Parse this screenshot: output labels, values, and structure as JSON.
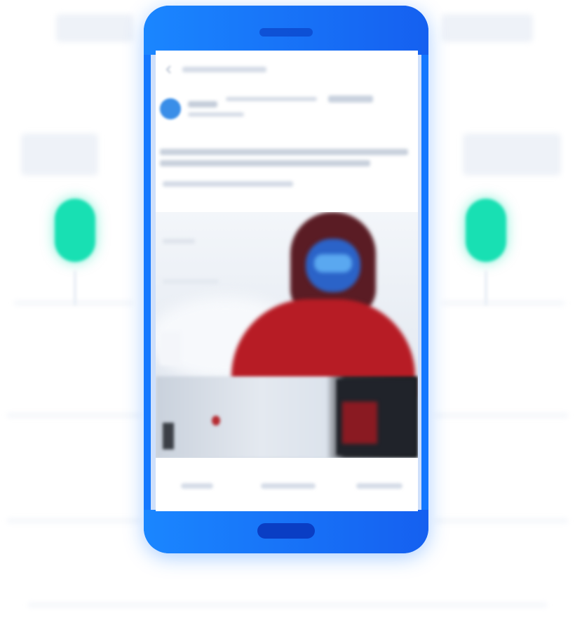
{
  "colors": {
    "device_accent": "#1478ff",
    "device_accent_dark": "#0b46c9",
    "indicator": "#18e0b3",
    "avatar": "#3a8ee8",
    "jacket": "#b71c25",
    "background": "#ffffff"
  },
  "device": {
    "kind": "smartphone mockup",
    "icons": {
      "speaker": "speaker-slot-icon",
      "home": "home-button-icon"
    }
  },
  "post": {
    "icons": {
      "back": "back-arrow-icon",
      "avatar": "avatar-icon",
      "photo": "photo-image"
    }
  },
  "side_indicators": {
    "left_icon": "green-capsule-icon",
    "right_icon": "green-capsule-icon"
  }
}
